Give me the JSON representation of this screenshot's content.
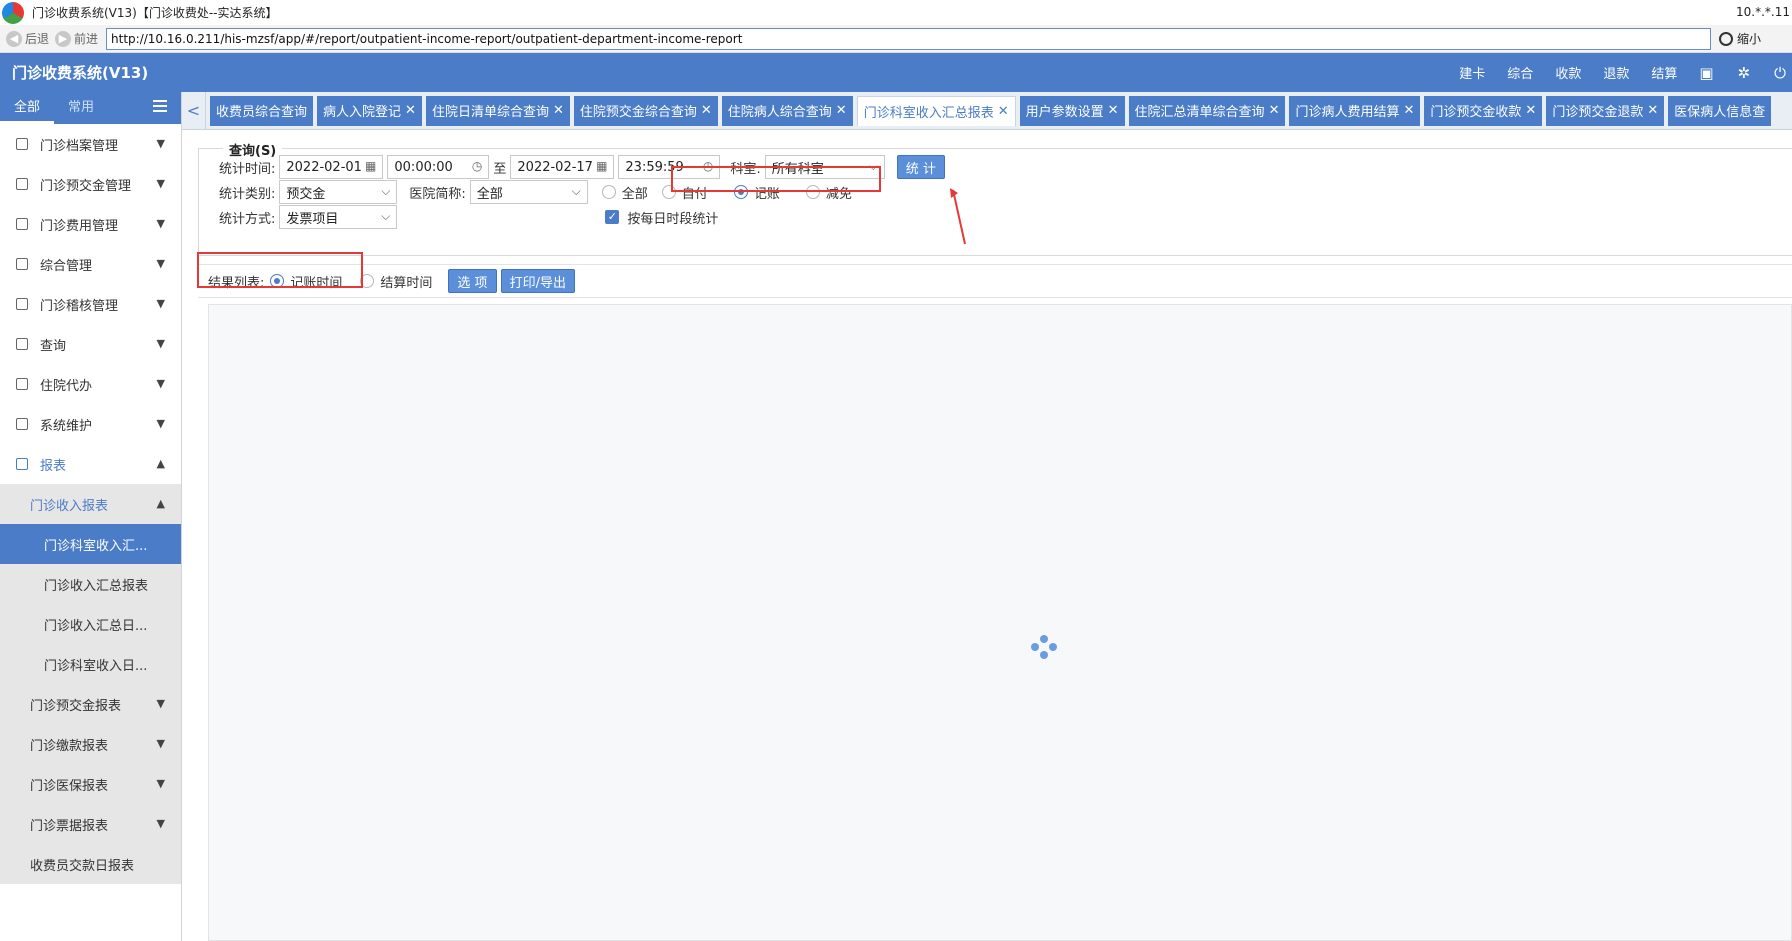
{
  "window": {
    "title": "门诊收费系统(V13)【门诊收费处--实达系统】",
    "ip_text": "10.*.*.11"
  },
  "address_bar": {
    "back_label": "后退",
    "forward_label": "前进",
    "url": "http://10.16.0.211/his-mzsf/app/#/report/outpatient-income-report/outpatient-department-income-report",
    "zoom_label": "缩小"
  },
  "header": {
    "app_title": "门诊收费系统(V13)",
    "menu": [
      "建卡",
      "综合",
      "收款",
      "退款",
      "结算"
    ]
  },
  "sidebar": {
    "tabs": {
      "all": "全部",
      "common": "常用"
    },
    "items": [
      {
        "label": "门诊档案管理"
      },
      {
        "label": "门诊预交金管理"
      },
      {
        "label": "门诊费用管理"
      },
      {
        "label": "综合管理"
      },
      {
        "label": "门诊稽核管理"
      },
      {
        "label": "查询"
      },
      {
        "label": "住院代办"
      },
      {
        "label": "系统维护"
      }
    ],
    "report": {
      "label": "报表",
      "income_group": "门诊收入报表",
      "income_items": [
        "门诊科室收入汇...",
        "门诊收入汇总报表",
        "门诊收入汇总日...",
        "门诊科室收入日..."
      ],
      "groups": [
        "门诊预交金报表",
        "门诊缴款报表",
        "门诊医保报表",
        "门诊票据报表"
      ],
      "last": "收费员交款日报表"
    }
  },
  "tabs": [
    {
      "label": "收费员综合查询",
      "closable": false
    },
    {
      "label": "病人入院登记",
      "closable": true
    },
    {
      "label": "住院日清单综合查询",
      "closable": true
    },
    {
      "label": "住院预交金综合查询",
      "closable": true
    },
    {
      "label": "住院病人综合查询",
      "closable": true
    },
    {
      "label": "门诊科室收入汇总报表",
      "closable": true,
      "active": true
    },
    {
      "label": "用户参数设置",
      "closable": true
    },
    {
      "label": "住院汇总清单综合查询",
      "closable": true
    },
    {
      "label": "门诊病人费用结算",
      "closable": true
    },
    {
      "label": "门诊预交金收款",
      "closable": true
    },
    {
      "label": "门诊预交金退款",
      "closable": true
    },
    {
      "label": "医保病人信息查",
      "closable": false
    }
  ],
  "query": {
    "legend": "查询(S)",
    "time_label": "统计时间:",
    "start_date": "2022-02-01",
    "start_time": "00:00:00",
    "to_label": "至",
    "end_date": "2022-02-17",
    "end_time": "23:59:59",
    "dept_label": "科室:",
    "dept_value": "所有科室",
    "stat_button": "统 计",
    "type_label": "统计类别:",
    "type_value": "预交金",
    "hospital_label": "医院简称:",
    "hospital_value": "全部",
    "radio_all": "全部",
    "radio_self": "自付",
    "radio_account": "记账",
    "radio_reduce": "减免",
    "method_label": "统计方式:",
    "method_value": "发票项目",
    "daily_checkbox": "按每日时段统计"
  },
  "result": {
    "label": "结果列表:",
    "radio_account_time": "记账时间",
    "radio_settle_time": "结算时间",
    "options_button": "选 项",
    "print_button": "打印/导出"
  }
}
